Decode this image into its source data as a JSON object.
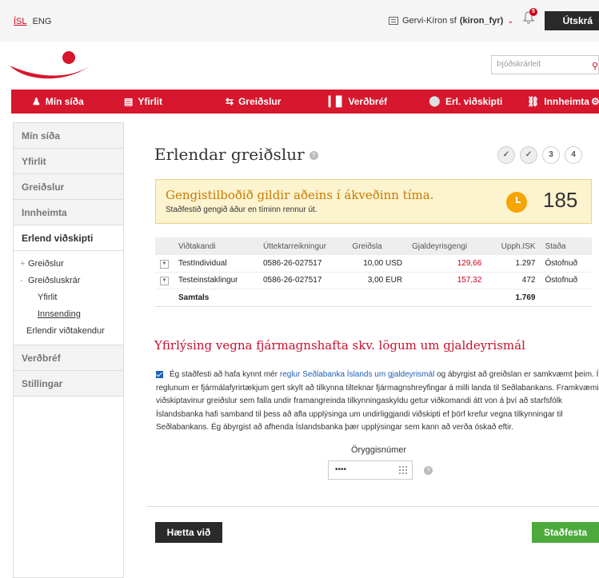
{
  "topbar": {
    "lang_active": "ÍSL",
    "lang_other": "ENG",
    "company_name": "Gervi-Kíron sf",
    "company_user": "(kiron_fyr)",
    "notification_count": "5",
    "logout_label": "Útskrá"
  },
  "search": {
    "placeholder": "Þjóðskrárleit"
  },
  "nav": [
    {
      "label": "Mín síða",
      "icon": "user-icon"
    },
    {
      "label": "Yfirlit",
      "icon": "documents-icon"
    },
    {
      "label": "Greiðslur",
      "icon": "transfer-arrows-icon"
    },
    {
      "label": "Verðbréf",
      "icon": "bar-chart-icon"
    },
    {
      "label": "Erl. viðskipti",
      "icon": "globe-icon"
    },
    {
      "label": "Innheimta",
      "icon": "collection-icon"
    }
  ],
  "sidebar": {
    "items": [
      "Mín síða",
      "Yfirlit",
      "Greiðslur",
      "Innheimta"
    ],
    "active": "Erlend viðskipti",
    "sub": {
      "payments_mark": "+",
      "payments": "Greiðslur",
      "registry_mark": "-",
      "registry": "Greiðsluskrár",
      "overview": "Yfirlit",
      "sending": "Innsending",
      "recipients": "Erlendir viðtakendur"
    },
    "bottom": [
      "Verðbréf",
      "Stillingar"
    ]
  },
  "page": {
    "title": "Erlendar greiðslur",
    "help": "?",
    "steps": [
      "3",
      "4"
    ]
  },
  "warning": {
    "heading": "Gengistilboðið gildir aðeins í ákveðinn tíma.",
    "subtext": "Staðfestið gengið áður en tíminn rennur út.",
    "countdown": "185"
  },
  "table": {
    "headers": [
      "Viðtakandi",
      "Úttektarreikningur",
      "Greiðsla",
      "Gjaldeyrisgengi",
      "Upph.ISK",
      "Staða"
    ],
    "rows": [
      {
        "recipient": "TestIndividual",
        "account": "0586-26-027517",
        "amount": "10,00 USD",
        "rate": "129,66",
        "isk": "1.297",
        "status": "Óstofnuð"
      },
      {
        "recipient": "Testeinstaklingur",
        "account": "0586-26-027517",
        "amount": "3,00 EUR",
        "rate": "157,32",
        "isk": "472",
        "status": "Óstofnuð"
      }
    ],
    "total_label": "Samtals",
    "total_value": "1.769"
  },
  "declaration": {
    "heading": "Yfirlýsing vegna fjármagnshafta skv. lögum um gjaldeyrismál",
    "text_before": "Ég staðfesti að hafa kynnt mér ",
    "link": "reglur Seðlabanka Íslands um gjaldeyrismál",
    "text_after": " og ábyrgist að greiðslan er samkvæmt þeim. Í reglunum er fjármálafyrirtækjum gert skylt að tilkynna tilteknar fjármagnshreyfingar á milli landa til Seðlabankans. Framkvæmi viðskiptavinur greiðslur sem falla undir framangreinda tilkynningaskyldu getur viðkomandi átt von á því að starfsfólk Íslandsbanka hafi samband til þess að afla upplýsinga um undirliggjandi viðskipti ef þörf krefur vegna tilkynningar til Seðlabankans. Ég ábyrgist að afhenda Íslandsbanka þær upplýsingar sem kann að verða óskað eftir."
  },
  "security": {
    "label": "Öryggisnúmer",
    "value": "••••"
  },
  "buttons": {
    "cancel": "Hætta við",
    "confirm": "Staðfesta"
  },
  "colors": {
    "brand_red": "#d6172d",
    "confirm_green": "#4caa3c",
    "warning_bg": "#fcf3cf"
  }
}
